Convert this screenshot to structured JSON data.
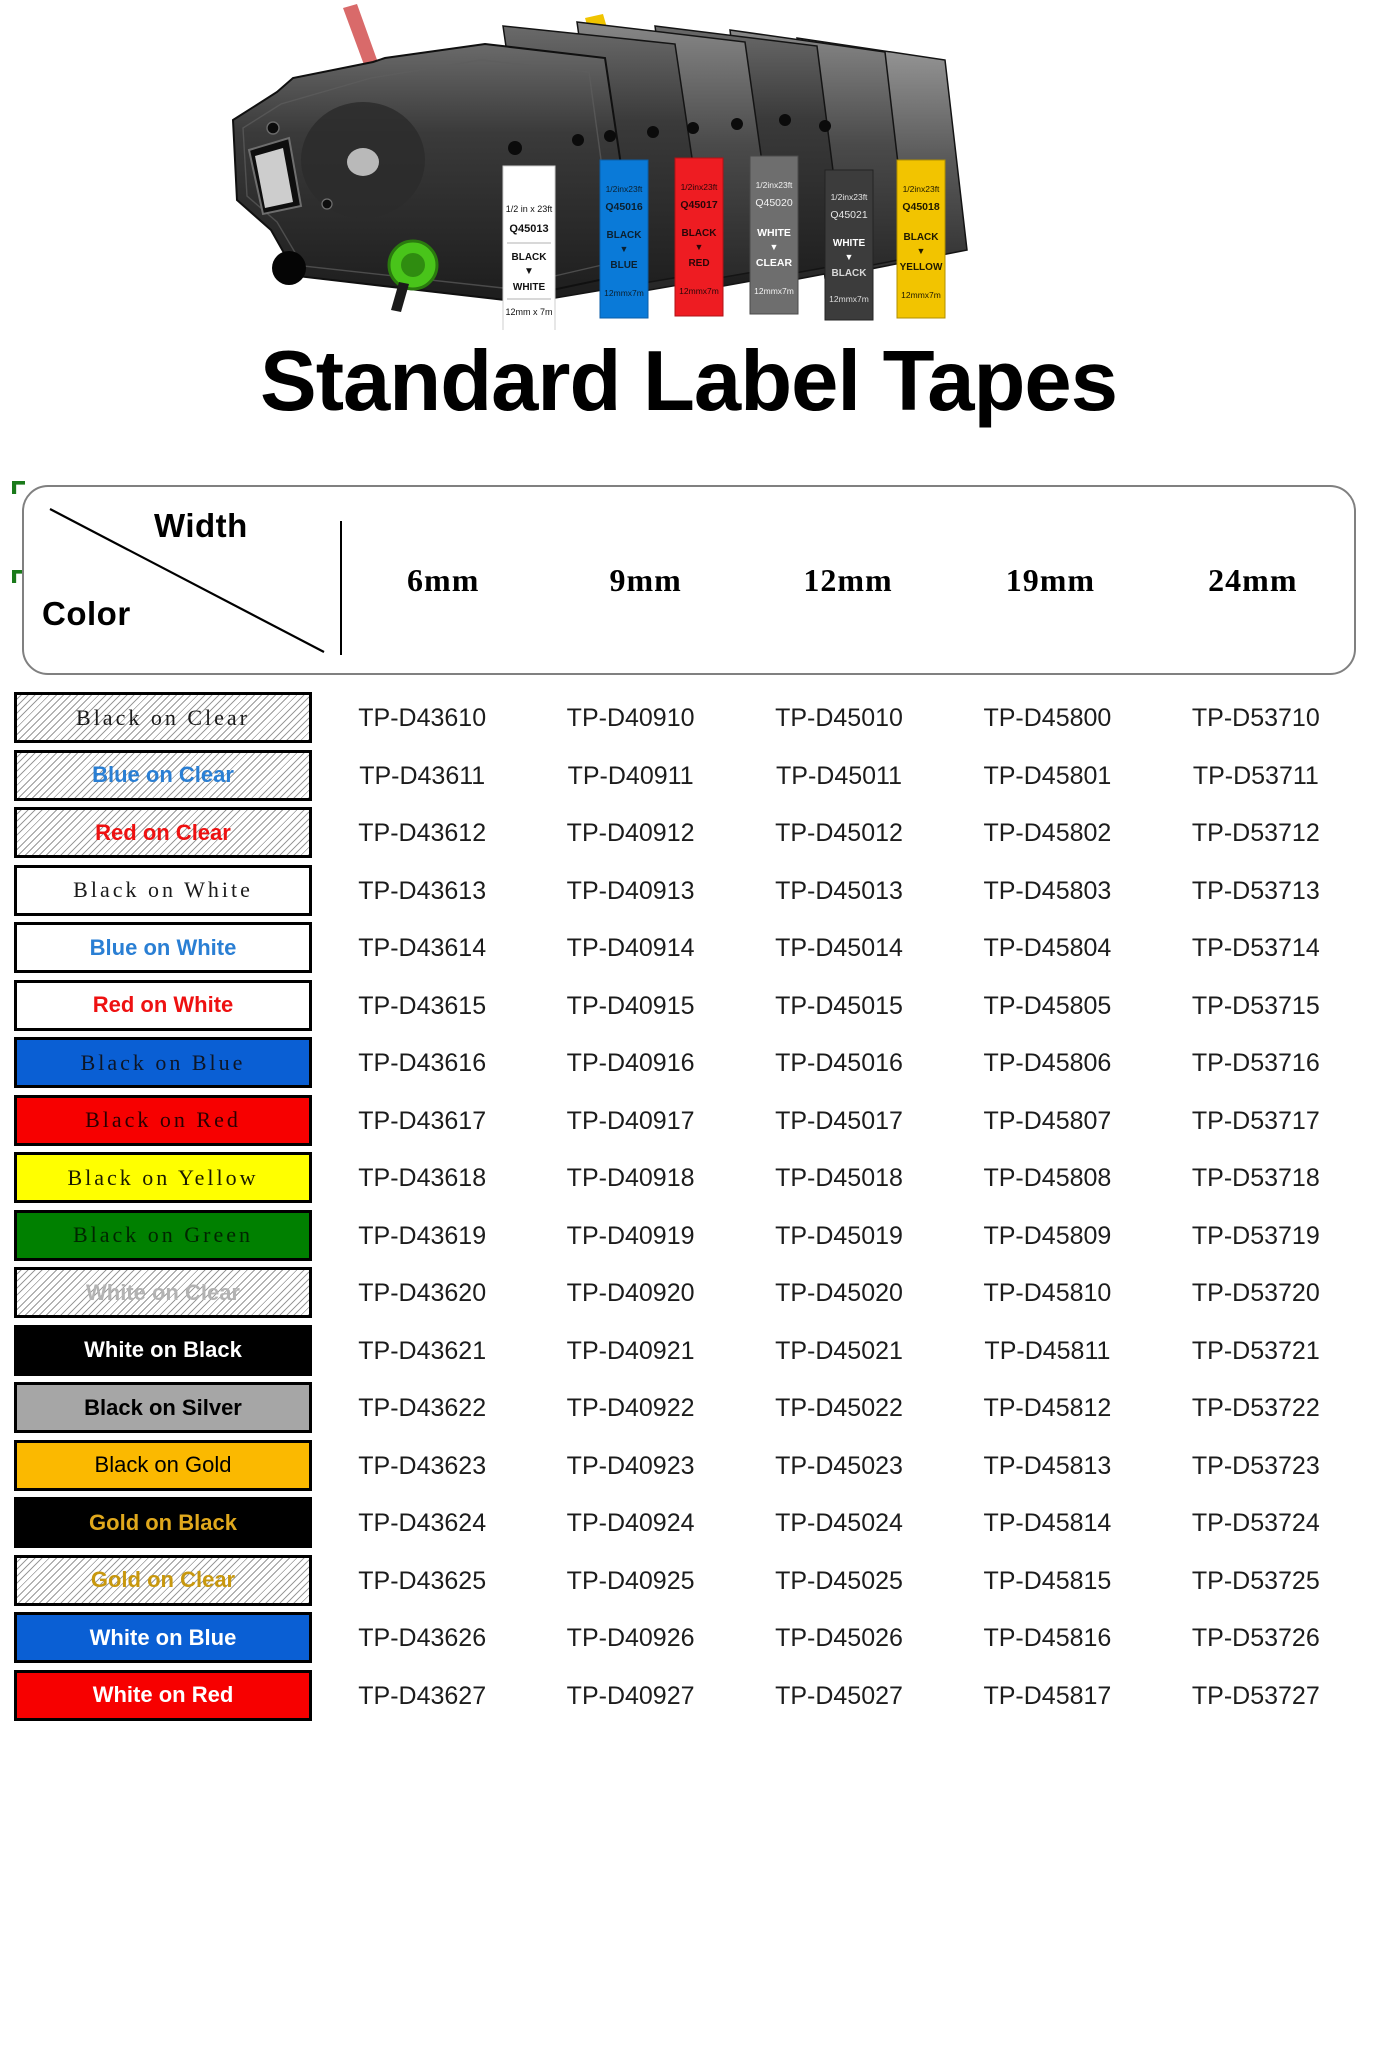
{
  "page_title": "Standard Label Tapes",
  "photo": {
    "alt_name": "label-tape-cartridges-photo",
    "cartridges": [
      {
        "size_imperial": "1/2 in x 23ft",
        "code": "Q45013",
        "print_color": "BLACK",
        "tape_color": "WHITE",
        "size_metric": "12mm x 7m",
        "label_bg": "#ffffff",
        "label_text": "#111111"
      },
      {
        "size_imperial": "1/2inx23ft",
        "code": "Q45016",
        "print_color": "BLACK",
        "tape_color": "BLUE",
        "size_metric": "12mmx7m",
        "label_bg": "#0a7ad8",
        "label_text": "#0b2030"
      },
      {
        "size_imperial": "1/2inx23ft",
        "code": "Q45017",
        "print_color": "BLACK",
        "tape_color": "RED",
        "size_metric": "12mmx7m",
        "label_bg": "#ee1c22",
        "label_text": "#2a0608"
      },
      {
        "size_imperial": "1/2inx23ft",
        "code": "Q45020",
        "print_color": "WHITE",
        "tape_color": "CLEAR",
        "size_metric": "12mmx7m",
        "label_bg": "#6e6e6e",
        "label_text": "#f2f2f2"
      },
      {
        "size_imperial": "1/2inx23ft",
        "code": "Q45021",
        "print_color": "WHITE",
        "tape_color": "BLACK",
        "size_metric": "12mmx7m",
        "label_bg": "#3c3c3c",
        "label_text": "#f0f0f0"
      },
      {
        "size_imperial": "1/2inx23ft",
        "code": "Q45018",
        "print_color": "BLACK",
        "tape_color": "YELLOW",
        "size_metric": "12mmx7m",
        "label_bg": "#f2c400",
        "label_text": "#201a00"
      }
    ]
  },
  "table": {
    "corner": {
      "width_label": "Width",
      "color_label": "Color"
    },
    "widths": [
      "6mm",
      "9mm",
      "12mm",
      "19mm",
      "24mm"
    ],
    "rows": [
      {
        "color": "Black on Clear",
        "swatch_bg": "hatched",
        "text_color": "#1a1a1a",
        "font": "font-serif-sp",
        "parts": [
          "TP-D43610",
          "TP-D40910",
          "TP-D45010",
          "TP-D45800",
          "TP-D53710"
        ]
      },
      {
        "color": "Blue on Clear",
        "swatch_bg": "hatched",
        "text_color": "#2a7fd4",
        "font": "font-sans-bold",
        "parts": [
          "TP-D43611",
          "TP-D40911",
          "TP-D45011",
          "TP-D45801",
          "TP-D53711"
        ]
      },
      {
        "color": "Red on Clear",
        "swatch_bg": "hatched",
        "text_color": "#ee1111",
        "font": "font-sans-bold",
        "parts": [
          "TP-D43612",
          "TP-D40912",
          "TP-D45012",
          "TP-D45802",
          "TP-D53712"
        ]
      },
      {
        "color": "Black on White",
        "swatch_bg": "#ffffff",
        "text_color": "#1a1a1a",
        "font": "font-serif-sp",
        "parts": [
          "TP-D43613",
          "TP-D40913",
          "TP-D45013",
          "TP-D45803",
          "TP-D53713"
        ]
      },
      {
        "color": "Blue on White",
        "swatch_bg": "#ffffff",
        "text_color": "#2a7fd4",
        "font": "font-sans-bold",
        "parts": [
          "TP-D43614",
          "TP-D40914",
          "TP-D45014",
          "TP-D45804",
          "TP-D53714"
        ]
      },
      {
        "color": "Red on White",
        "swatch_bg": "#ffffff",
        "text_color": "#ee1111",
        "font": "font-sans-bold",
        "parts": [
          "TP-D43615",
          "TP-D40915",
          "TP-D45015",
          "TP-D45805",
          "TP-D53715"
        ]
      },
      {
        "color": "Black on Blue",
        "swatch_bg": "#0a5fd4",
        "text_color": "#0d1626",
        "font": "font-serif-sp",
        "parts": [
          "TP-D43616",
          "TP-D40916",
          "TP-D45016",
          "TP-D45806",
          "TP-D53716"
        ]
      },
      {
        "color": "Black on Red",
        "swatch_bg": "#f70000",
        "text_color": "#2a0000",
        "font": "font-serif-sp",
        "parts": [
          "TP-D43617",
          "TP-D40917",
          "TP-D45017",
          "TP-D45807",
          "TP-D53717"
        ]
      },
      {
        "color": "Black on Yellow",
        "swatch_bg": "#ffff00",
        "text_color": "#1a1a00",
        "font": "font-serif-sp",
        "parts": [
          "TP-D43618",
          "TP-D40918",
          "TP-D45018",
          "TP-D45808",
          "TP-D53718"
        ]
      },
      {
        "color": "Black on Green",
        "swatch_bg": "#008000",
        "text_color": "#002600",
        "font": "font-serif-sp",
        "parts": [
          "TP-D43619",
          "TP-D40919",
          "TP-D45019",
          "TP-D45809",
          "TP-D53719"
        ]
      },
      {
        "color": "White on Clear",
        "swatch_bg": "hatched",
        "text_color": "#b3b3b3",
        "font": "font-sans-bold",
        "parts": [
          "TP-D43620",
          "TP-D40920",
          "TP-D45020",
          "TP-D45810",
          "TP-D53720"
        ]
      },
      {
        "color": "White on Black",
        "swatch_bg": "#000000",
        "text_color": "#ffffff",
        "font": "font-sans-bold",
        "parts": [
          "TP-D43621",
          "TP-D40921",
          "TP-D45021",
          "TP-D45811",
          "TP-D53721"
        ]
      },
      {
        "color": "Black on Silver",
        "swatch_bg": "#a6a6a6",
        "text_color": "#000000",
        "font": "font-sans-bold",
        "parts": [
          "TP-D43622",
          "TP-D40922",
          "TP-D45022",
          "TP-D45812",
          "TP-D53722"
        ]
      },
      {
        "color": "Black on Gold",
        "swatch_bg": "#fbb900",
        "text_color": "#000000",
        "font": "font-sans-reg",
        "parts": [
          "TP-D43623",
          "TP-D40923",
          "TP-D45023",
          "TP-D45813",
          "TP-D53723"
        ]
      },
      {
        "color": "Gold on Black",
        "swatch_bg": "#000000",
        "text_color": "#e0a81c",
        "font": "font-sans-bold",
        "parts": [
          "TP-D43624",
          "TP-D40924",
          "TP-D45024",
          "TP-D45814",
          "TP-D53724"
        ]
      },
      {
        "color": "Gold on Clear",
        "swatch_bg": "hatched",
        "text_color": "#c8980f",
        "font": "font-sans-bold",
        "parts": [
          "TP-D43625",
          "TP-D40925",
          "TP-D45025",
          "TP-D45815",
          "TP-D53725"
        ]
      },
      {
        "color": "White on Blue",
        "swatch_bg": "#0a5fd4",
        "text_color": "#ffffff",
        "font": "font-sans-bold",
        "parts": [
          "TP-D43626",
          "TP-D40926",
          "TP-D45026",
          "TP-D45816",
          "TP-D53726"
        ]
      },
      {
        "color": "White on Red",
        "swatch_bg": "#f70000",
        "text_color": "#ffffff",
        "font": "font-sans-bold",
        "parts": [
          "TP-D43627",
          "TP-D40927",
          "TP-D45027",
          "TP-D45817",
          "TP-D53727"
        ]
      }
    ]
  },
  "colors": {
    "green_marker": "#1a7a1a",
    "header_border": "#808080"
  }
}
